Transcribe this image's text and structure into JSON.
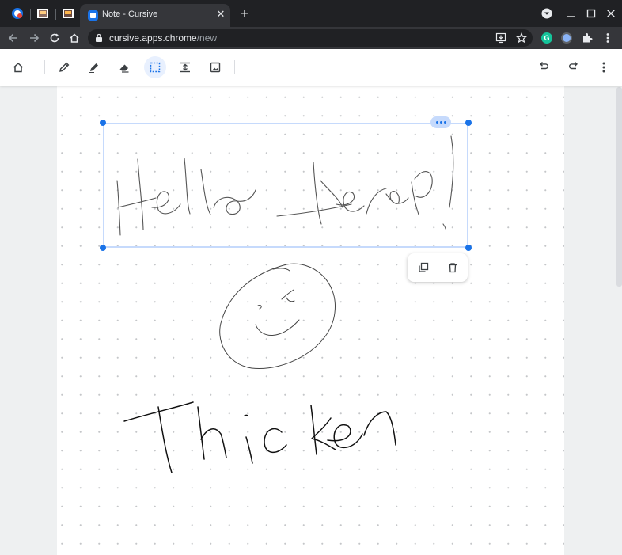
{
  "browser": {
    "active_tab_title": "Note - Cursive",
    "url_host": "cursive.apps.chrome",
    "url_path": "/new"
  },
  "extensions": {
    "grammarly_letter": "G"
  },
  "app_toolbar": {
    "active_tool": "select"
  },
  "canvas": {
    "selection_menu": "more",
    "selection_actions": [
      "duplicate",
      "delete"
    ]
  },
  "colors": {
    "accent": "#1a73e8",
    "selection_border": "#c6dafc",
    "chrome_dark": "#202124",
    "chrome_toolbar": "#35363a"
  }
}
